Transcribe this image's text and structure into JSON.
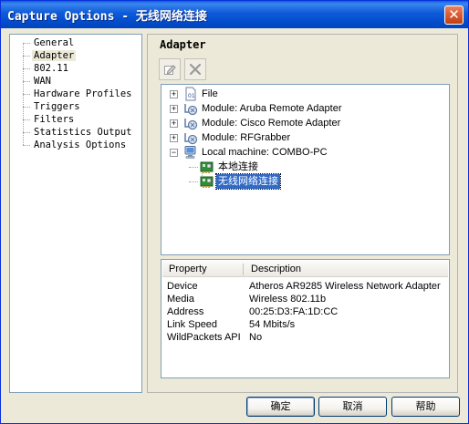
{
  "window": {
    "title": "Capture Options - 无线网络连接",
    "close_glyph": "✕"
  },
  "nav": {
    "items": [
      {
        "label": "General",
        "selected": false
      },
      {
        "label": "Adapter",
        "selected": true
      },
      {
        "label": "802.11",
        "selected": false
      },
      {
        "label": "WAN",
        "selected": false
      },
      {
        "label": "Hardware Profiles",
        "selected": false
      },
      {
        "label": "Triggers",
        "selected": false
      },
      {
        "label": "Filters",
        "selected": false
      },
      {
        "label": "Statistics Output",
        "selected": false
      },
      {
        "label": "Analysis Options",
        "selected": false
      }
    ]
  },
  "content": {
    "heading": "Adapter"
  },
  "toolbar": {
    "edit_icon": "edit-icon",
    "delete_icon": "delete-x-icon"
  },
  "tree": {
    "nodes": [
      {
        "label": "File",
        "expander": "+",
        "icon": "file-icon"
      },
      {
        "label": "Module: Aruba Remote Adapter",
        "expander": "+",
        "icon": "module-icon"
      },
      {
        "label": "Module: Cisco Remote Adapter",
        "expander": "+",
        "icon": "module-icon"
      },
      {
        "label": "Module: RFGrabber",
        "expander": "+",
        "icon": "module-icon"
      },
      {
        "label": "Local machine: COMBO-PC",
        "expander": "−",
        "icon": "computer-icon"
      },
      {
        "label": "本地连接",
        "expander": "",
        "icon": "network-adapter-icon"
      },
      {
        "label": "无线网络连接",
        "expander": "",
        "icon": "network-adapter-icon",
        "selected": true
      }
    ]
  },
  "properties": {
    "headers": {
      "property": "Property",
      "description": "Description"
    },
    "rows": [
      {
        "name": "Device",
        "value": "Atheros AR9285 Wireless Network Adapter"
      },
      {
        "name": "Media",
        "value": "Wireless 802.11b"
      },
      {
        "name": "Address",
        "value": "00:25:D3:FA:1D:CC"
      },
      {
        "name": "Link Speed",
        "value": "54 Mbits/s"
      },
      {
        "name": "WildPackets API",
        "value": "No"
      }
    ]
  },
  "buttons": {
    "ok": "确定",
    "cancel": "取消",
    "help": "帮助"
  },
  "colors": {
    "selection": "#316ac5",
    "titlebar": "#0054e3",
    "close": "#d85b33"
  }
}
